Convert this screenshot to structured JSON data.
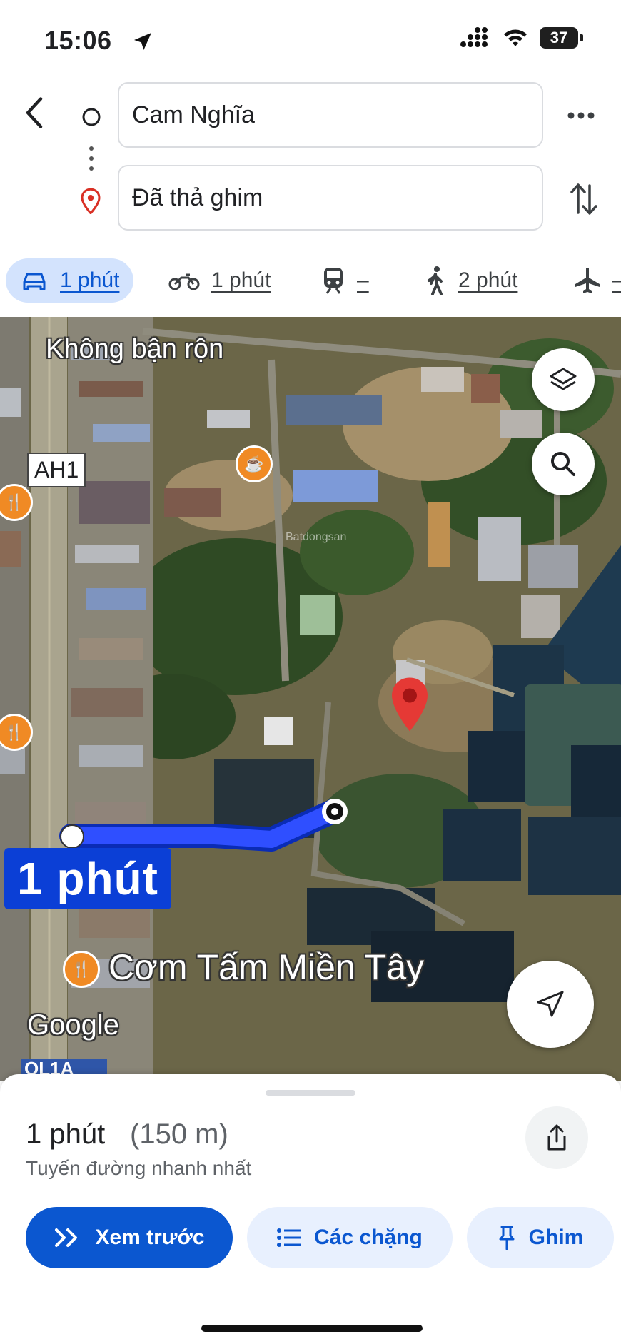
{
  "status": {
    "time": "15:06",
    "battery": "37"
  },
  "route": {
    "origin": "Cam Nghĩa",
    "destination": "Đã thả ghim"
  },
  "modes": [
    {
      "name": "car",
      "label": "1 phút",
      "active": true
    },
    {
      "name": "motorbike",
      "label": "1 phút"
    },
    {
      "name": "transit",
      "label": "–"
    },
    {
      "name": "walk",
      "label": "2 phút"
    },
    {
      "name": "flight",
      "label": "–"
    }
  ],
  "map": {
    "traffic_label": "Không bận rộn",
    "road_label_ah1": "AH1",
    "road_label_ql": "QL1A",
    "route_time_label": "1 phút",
    "poi_label": "Cơm Tấm Miền Tây",
    "google_logo": "Google",
    "watermark": "Batdongsan"
  },
  "summary": {
    "duration": "1 phút",
    "distance": "(150 m)",
    "subtitle": "Tuyến đường nhanh nhất"
  },
  "actions": {
    "preview": "Xem trước",
    "steps": "Các chặng",
    "pin": "Ghim"
  },
  "colors": {
    "accent": "#0b57d0",
    "route": "#1a44ff",
    "pin": "#e53935"
  }
}
